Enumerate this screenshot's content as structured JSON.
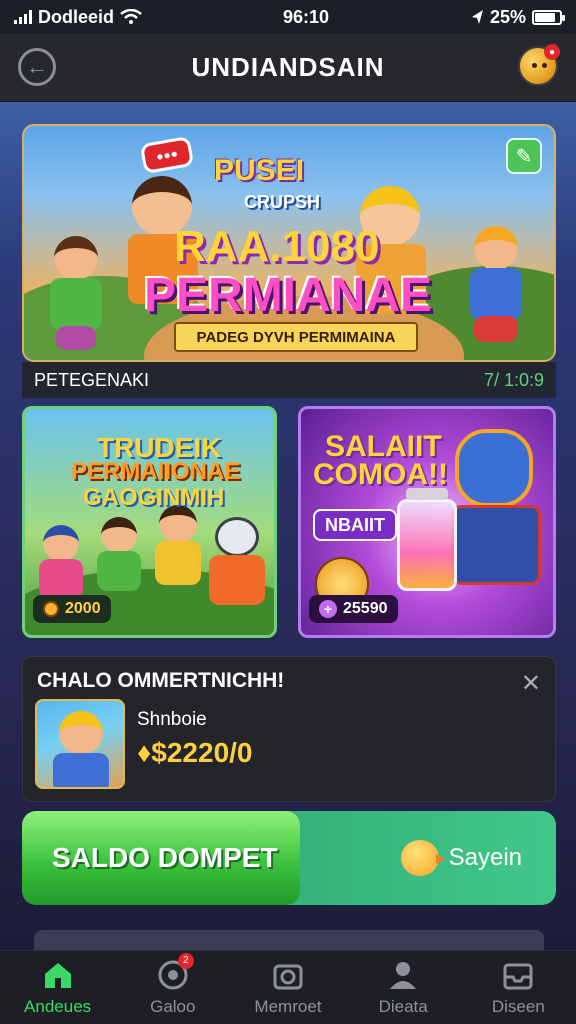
{
  "status_bar": {
    "carrier": "Dodleeid",
    "time": "96:10",
    "battery": "25%",
    "battery_level": 0.85
  },
  "header": {
    "title": "UNDIANDSAIN",
    "back_icon": "back-arrow-icon",
    "profile_icon": "profile-avatar-icon",
    "profile_badge": "●"
  },
  "hero": {
    "sign_text": "●●●",
    "title_line1": "PUSEI",
    "title_line2": "CRUPSH",
    "title_line3": "RAA.1080",
    "title_line4": "PERMIANAE",
    "subtitle": "PADEG DYVH PERMIMAINA",
    "footer_label": "PETEGENAKI",
    "footer_time": "7/ 1:0:9",
    "action_icon": "share-icon"
  },
  "cards": [
    {
      "title_lines": [
        "TRUDEIK",
        "PERMAIIONAE",
        "GAOGINMIH"
      ],
      "price": "2000"
    },
    {
      "title_lines": [
        "SALAIIT",
        "COMOA!!"
      ],
      "tag": "NBAIIT",
      "price": "25590"
    }
  ],
  "notice": {
    "title": "CHALO OMMERTNICHH!",
    "item_name": "Shnboie",
    "item_price": "♦$2220/0",
    "close_icon": "close-icon"
  },
  "wallet": {
    "label": "SALDO DOMPET",
    "side_label": "Sayein"
  },
  "bottom_nav": [
    {
      "label": "Andeues",
      "icon": "home-icon",
      "active": true
    },
    {
      "label": "Galoo",
      "icon": "game-icon",
      "badge": "2"
    },
    {
      "label": "Memroet",
      "icon": "camera-icon"
    },
    {
      "label": "Dieata",
      "icon": "user-icon"
    },
    {
      "label": "Diseen",
      "icon": "inbox-icon"
    }
  ],
  "colors": {
    "accent_green": "#3ad866",
    "gold": "#ffcf3d",
    "badge_red": "#e0262c"
  }
}
